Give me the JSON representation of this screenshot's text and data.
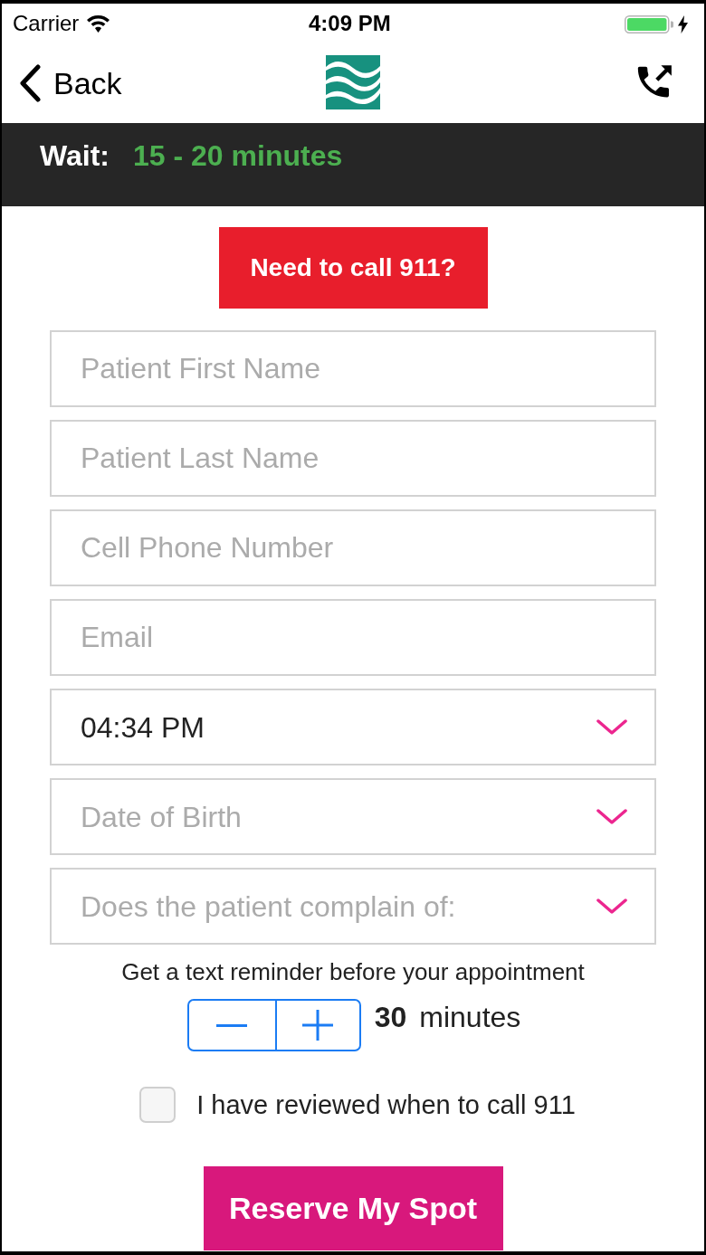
{
  "status_bar": {
    "carrier": "Carrier",
    "time": "4:09 PM",
    "charging": true
  },
  "nav_bar": {
    "back_label": "Back"
  },
  "wait_banner": {
    "label": "Wait:",
    "value": "15 - 20 minutes"
  },
  "emergency_button": {
    "label": "Need to call 911?"
  },
  "fields": [
    {
      "kind": "text",
      "placeholder": "Patient First Name"
    },
    {
      "kind": "text",
      "placeholder": "Patient Last Name"
    },
    {
      "kind": "text",
      "placeholder": "Cell Phone Number"
    },
    {
      "kind": "text",
      "placeholder": "Email"
    },
    {
      "kind": "select",
      "value": "04:34 PM"
    },
    {
      "kind": "select",
      "placeholder": "Date of Birth"
    },
    {
      "kind": "select",
      "placeholder": "Does the patient complain of:"
    }
  ],
  "reminder": {
    "prompt": "Get a text reminder before your appointment",
    "amount": "30",
    "unit": "minutes"
  },
  "acknowledgement": {
    "label": "I have reviewed when to call 911",
    "checked": false
  },
  "submit_button": {
    "label": "Reserve My Spot"
  }
}
